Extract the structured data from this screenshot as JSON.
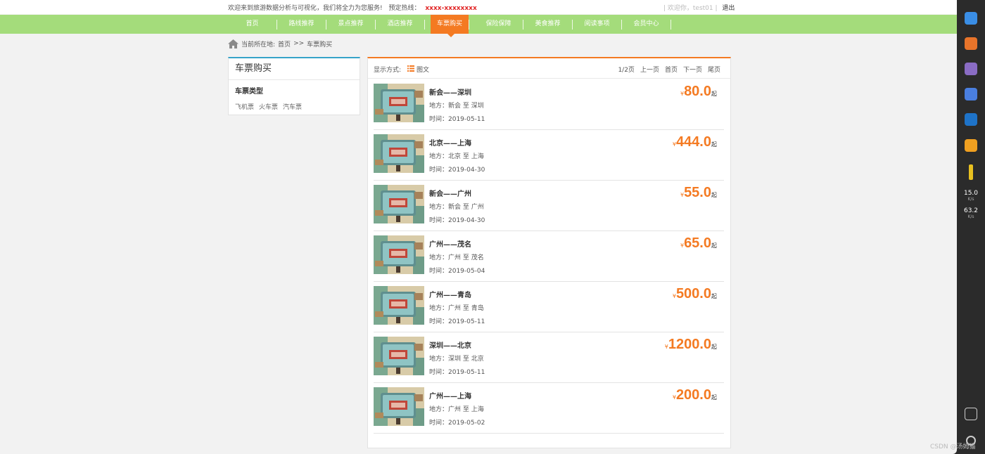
{
  "topbar": {
    "welcome_text": "欢迎来到旅游数据分析与可视化，我们将全力为您服务!",
    "hotline_label": "预定热线：",
    "hotline_value": "xxxx-xxxxxxxx",
    "user_greeting": "| 欢迎你，test01 |",
    "logout_label": "退出"
  },
  "nav": {
    "items": [
      {
        "label": "首页"
      },
      {
        "label": "路线推荐"
      },
      {
        "label": "景点推荐"
      },
      {
        "label": "酒店推荐"
      },
      {
        "label": "车票购买"
      },
      {
        "label": "保险保障"
      },
      {
        "label": "美食推荐"
      },
      {
        "label": "阅读事项"
      },
      {
        "label": "会员中心"
      }
    ],
    "active_index": 4
  },
  "breadcrumb": {
    "prefix": "当前所在地:",
    "home": "首页",
    "sep": ">>",
    "current": "车票购买"
  },
  "sidebar": {
    "title": "车票购买",
    "subtitle": "车票类型",
    "links": [
      "飞机票",
      "火车票",
      "汽车票"
    ]
  },
  "toolbar": {
    "display_label": "显示方式:",
    "mode_label": "图文",
    "page_info": "1/2页",
    "prev": "上一页",
    "first": "首页",
    "next": "下一页",
    "last": "尾页"
  },
  "tickets": [
    {
      "title": "新会——深圳",
      "place": "地方：新会 至 深圳",
      "time": "时间：2019-05-11",
      "currency": "¥",
      "price": "80.0",
      "suffix": "起"
    },
    {
      "title": "北京——上海",
      "place": "地方：北京 至 上海",
      "time": "时间：2019-04-30",
      "currency": "¥",
      "price": "444.0",
      "suffix": "起"
    },
    {
      "title": "新会——广州",
      "place": "地方：新会 至 广州",
      "time": "时间：2019-04-30",
      "currency": "¥",
      "price": "55.0",
      "suffix": "起"
    },
    {
      "title": "广州——茂名",
      "place": "地方：广州 至 茂名",
      "time": "时间：2019-05-04",
      "currency": "¥",
      "price": "65.0",
      "suffix": "起"
    },
    {
      "title": "广州——青岛",
      "place": "地方：广州 至 青岛",
      "time": "时间：2019-05-11",
      "currency": "¥",
      "price": "500.0",
      "suffix": "起"
    },
    {
      "title": "深圳——北京",
      "place": "地方：深圳 至 北京",
      "time": "时间：2019-05-11",
      "currency": "¥",
      "price": "1200.0",
      "suffix": "起"
    },
    {
      "title": "广州——上海",
      "place": "地方：广州 至 上海",
      "time": "时间：2019-05-02",
      "currency": "¥",
      "price": "200.0",
      "suffix": "起"
    }
  ],
  "dock": {
    "speed_up": "15.0",
    "speed_up_unit": "K/s",
    "speed_down": "63.2",
    "speed_down_unit": "K/s"
  },
  "watermark": "CSDN @汤姆猫",
  "colors": {
    "nav_green": "#a4dc7b",
    "accent_orange": "#f47a22",
    "sidebar_blue": "#36a3c8",
    "hotline_red": "#e02020"
  }
}
